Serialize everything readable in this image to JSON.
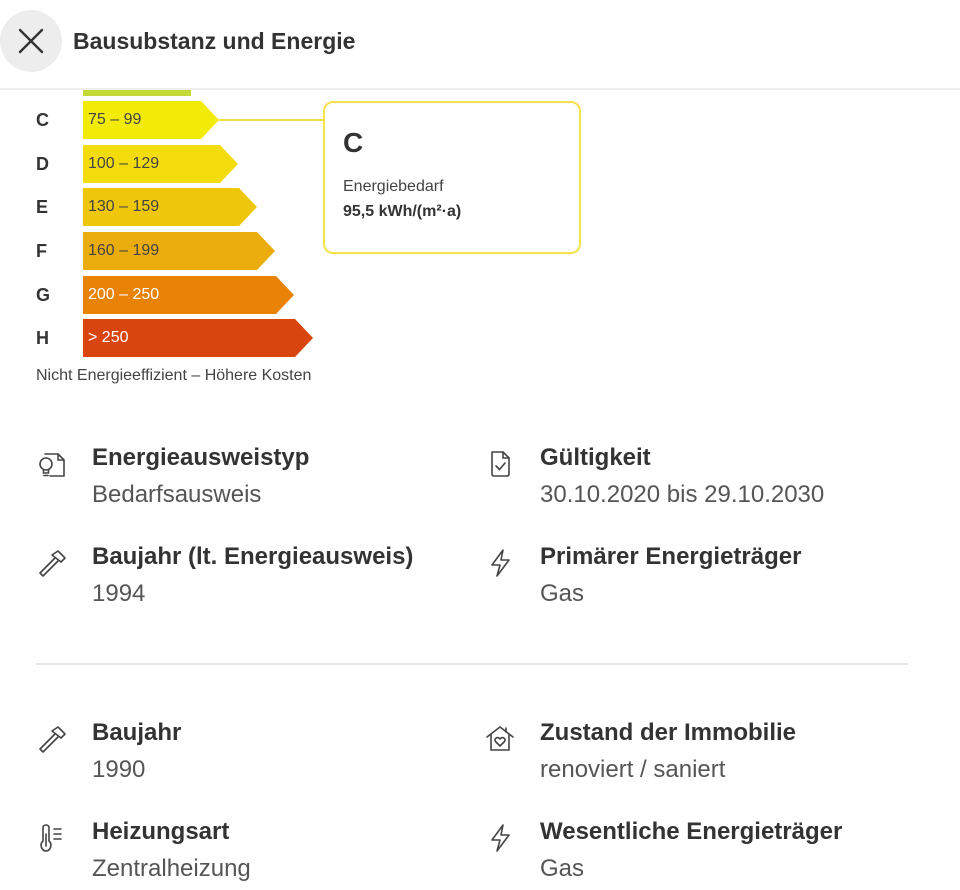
{
  "header": {
    "title": "Bausubstanz und Energie"
  },
  "energy": {
    "ratings": [
      {
        "letter": "C",
        "range": "75 – 99",
        "color": "#f2ea07"
      },
      {
        "letter": "D",
        "range": "100 – 129",
        "color": "#f2dc0b"
      },
      {
        "letter": "E",
        "range": "130 – 159",
        "color": "#efc70a"
      },
      {
        "letter": "F",
        "range": "160 – 199",
        "color": "#ebad0d"
      },
      {
        "letter": "G",
        "range": "200 – 250",
        "color": "#e88305"
      },
      {
        "letter": "H",
        "range": "> 250",
        "color": "#d9450e"
      }
    ],
    "callout": {
      "class": "C",
      "label": "Energiebedarf",
      "value": "95,5 kWh/(m²·a)"
    },
    "caption": "Nicht Energieeffizient – Höhere Kosten"
  },
  "details": {
    "ausweistyp": {
      "label": "Energieausweistyp",
      "value": "Bedarfsausweis",
      "icon": "lightbulb-document-icon"
    },
    "gueltigkeit": {
      "label": "Gültigkeit",
      "value": "30.10.2020 bis 29.10.2030",
      "icon": "document-check-icon"
    },
    "baujahr_ausweis": {
      "label": "Baujahr (lt. Energieausweis)",
      "value": "1994",
      "icon": "hammer-icon"
    },
    "primaer": {
      "label": "Primärer Energieträger",
      "value": "Gas",
      "icon": "lightning-icon"
    },
    "baujahr": {
      "label": "Baujahr",
      "value": "1990",
      "icon": "hammer-icon"
    },
    "zustand": {
      "label": "Zustand der Immobilie",
      "value": "renoviert / saniert",
      "icon": "house-heart-icon"
    },
    "heizung": {
      "label": "Heizungsart",
      "value": "Zentralheizung",
      "icon": "thermometer-icon"
    },
    "wesentlich": {
      "label": "Wesentliche Energieträger",
      "value": "Gas",
      "icon": "lightning-icon"
    }
  }
}
